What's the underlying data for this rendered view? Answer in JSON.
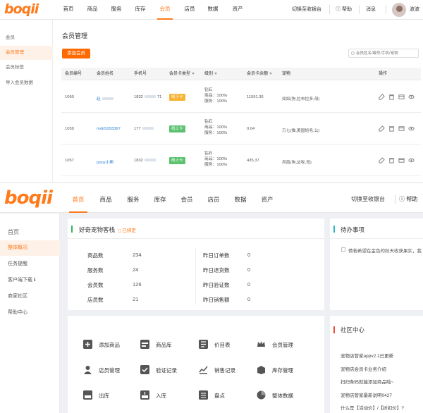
{
  "top": {
    "logo": "boqii",
    "nav": [
      "首页",
      "商品",
      "服务",
      "库存",
      "会员",
      "店员",
      "数据",
      "资产"
    ],
    "nav_active": "会员",
    "switch_label": "切换至收银台",
    "help_label": "帮助",
    "messages_label": "消息",
    "user_name": "波波",
    "sidebar": [
      "会员",
      "会员管理",
      "会员标签",
      "导入会员数据"
    ],
    "sidebar_active": "会员管理",
    "page_title": "会员管理",
    "add_button": "添加会员",
    "search_placeholder": "会员姓名/编号/手机/宠物",
    "columns": [
      "会员编号",
      "会员姓名",
      "手机号",
      "会员卡类型",
      "级别",
      "会员卡余额",
      "宠物",
      "操作"
    ],
    "rows": [
      {
        "id": "1060",
        "name": "赵",
        "phone_prefix": "1832",
        "phone_suffix": "71",
        "card_type": "线下卡",
        "card_color": "#f7b334",
        "level": "钻石",
        "product_discount": "商品：100%",
        "service_discount": "服务：100%",
        "balance": "11591.36",
        "pet": "如如(狗,拉布拉多,母)"
      },
      {
        "id": "1059",
        "name": "mob5293367",
        "phone_prefix": "177",
        "phone_suffix": "",
        "card_type": "线上卡",
        "card_color": "#5cc26f",
        "level": "钻石",
        "product_discount": "商品：100%",
        "service_discount": "服务：100%",
        "balance": "0.04",
        "pet": "万七(猫,美国短毛,公)"
      },
      {
        "id": "1057",
        "name": "pony小熊",
        "phone_prefix": "1832",
        "phone_suffix": "",
        "card_type": "线上卡",
        "card_color": "#5cc26f",
        "level": "钻石",
        "product_discount": "商品：100%",
        "service_discount": "服务：100%",
        "balance": "435.37",
        "pet": "风扇(狗,边牧,母)"
      }
    ]
  },
  "bottom": {
    "logo": "boqii",
    "nav": [
      "首页",
      "商品",
      "服务",
      "库存",
      "会员",
      "店员",
      "数据",
      "资产"
    ],
    "nav_active": "首页",
    "switch_label": "切换至收银台",
    "help_label": "帮助",
    "sidebar": [
      "首页",
      "整体概况",
      "任务提醒",
      "客户端下载 ℹ",
      "商家社区",
      "帮助中心"
    ],
    "sidebar_active": "整体概况",
    "store_name": "好奇宠物客栈",
    "bound_label": "已绑定",
    "stats_left": [
      {
        "label": "商品数",
        "value": "234"
      },
      {
        "label": "服务数",
        "value": "24"
      },
      {
        "label": "会员数",
        "value": "126"
      },
      {
        "label": "店员数",
        "value": "21"
      }
    ],
    "stats_right": [
      {
        "label": "昨日订单数",
        "value": "0"
      },
      {
        "label": "昨日退货数",
        "value": "0"
      },
      {
        "label": "昨日验证数",
        "value": "0"
      },
      {
        "label": "昨日销售额",
        "value": "0"
      }
    ],
    "todo_title": "待办事项",
    "todo_item": "倩若希望在金色的秋天收获果实，我",
    "shortcuts": [
      {
        "label": "添加商品",
        "icon": "add-product-icon"
      },
      {
        "label": "商品库",
        "icon": "product-library-icon"
      },
      {
        "label": "价目表",
        "icon": "price-list-icon"
      },
      {
        "label": "会员管理",
        "icon": "crown-icon"
      },
      {
        "label": "店员管理",
        "icon": "staff-icon"
      },
      {
        "label": "验证记录",
        "icon": "verify-record-icon"
      },
      {
        "label": "销售记录",
        "icon": "sales-chart-icon"
      },
      {
        "label": "库存管理",
        "icon": "inventory-icon"
      },
      {
        "label": "出库",
        "icon": "outbound-icon"
      },
      {
        "label": "入库",
        "icon": "inbound-icon"
      },
      {
        "label": "盘点",
        "icon": "stocktake-icon"
      },
      {
        "label": "整体数据",
        "icon": "pie-chart-icon"
      }
    ],
    "community_title": "社区中心",
    "news": [
      "宠物店管家appv2.1已更新",
      "宠物店会员卡业务介绍",
      "扫扫条码就能添加商品啦~",
      "宠物店管家最新说明0427",
      "什么是【活动价】/【折扣价】?"
    ]
  }
}
